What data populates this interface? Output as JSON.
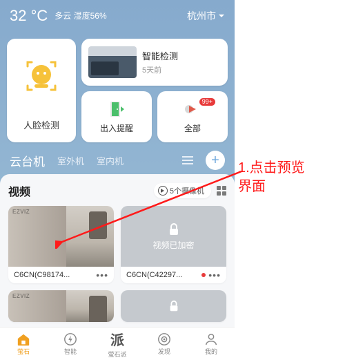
{
  "weather": {
    "temp": "32 °C",
    "desc_line1": "多云 湿度56%",
    "city": "杭州市"
  },
  "cards": {
    "face": {
      "label": "人脸检测"
    },
    "smart": {
      "title": "智能检测",
      "sub": "5天前"
    },
    "inout": {
      "label": "出入提醒"
    },
    "all": {
      "label": "全部",
      "badge": "99+"
    }
  },
  "section_tabs": {
    "a": "云台机",
    "b": "室外机",
    "c": "室内机"
  },
  "panel": {
    "title": "视频",
    "cam_count": "5个摄像机"
  },
  "cams": [
    {
      "name": "C6CN(C98174...",
      "encrypted": false
    },
    {
      "name": "C6CN(C42297...",
      "encrypted": true,
      "enc_text": "视频已加密",
      "recording": true
    }
  ],
  "brand_tag": "EZVIZ",
  "bottom_nav": {
    "a": "萤石",
    "b": "智能",
    "c": "萤石派",
    "d": "发现",
    "e": "我的"
  },
  "annotation": {
    "l1": "1.点击预览",
    "l2": "界面"
  }
}
